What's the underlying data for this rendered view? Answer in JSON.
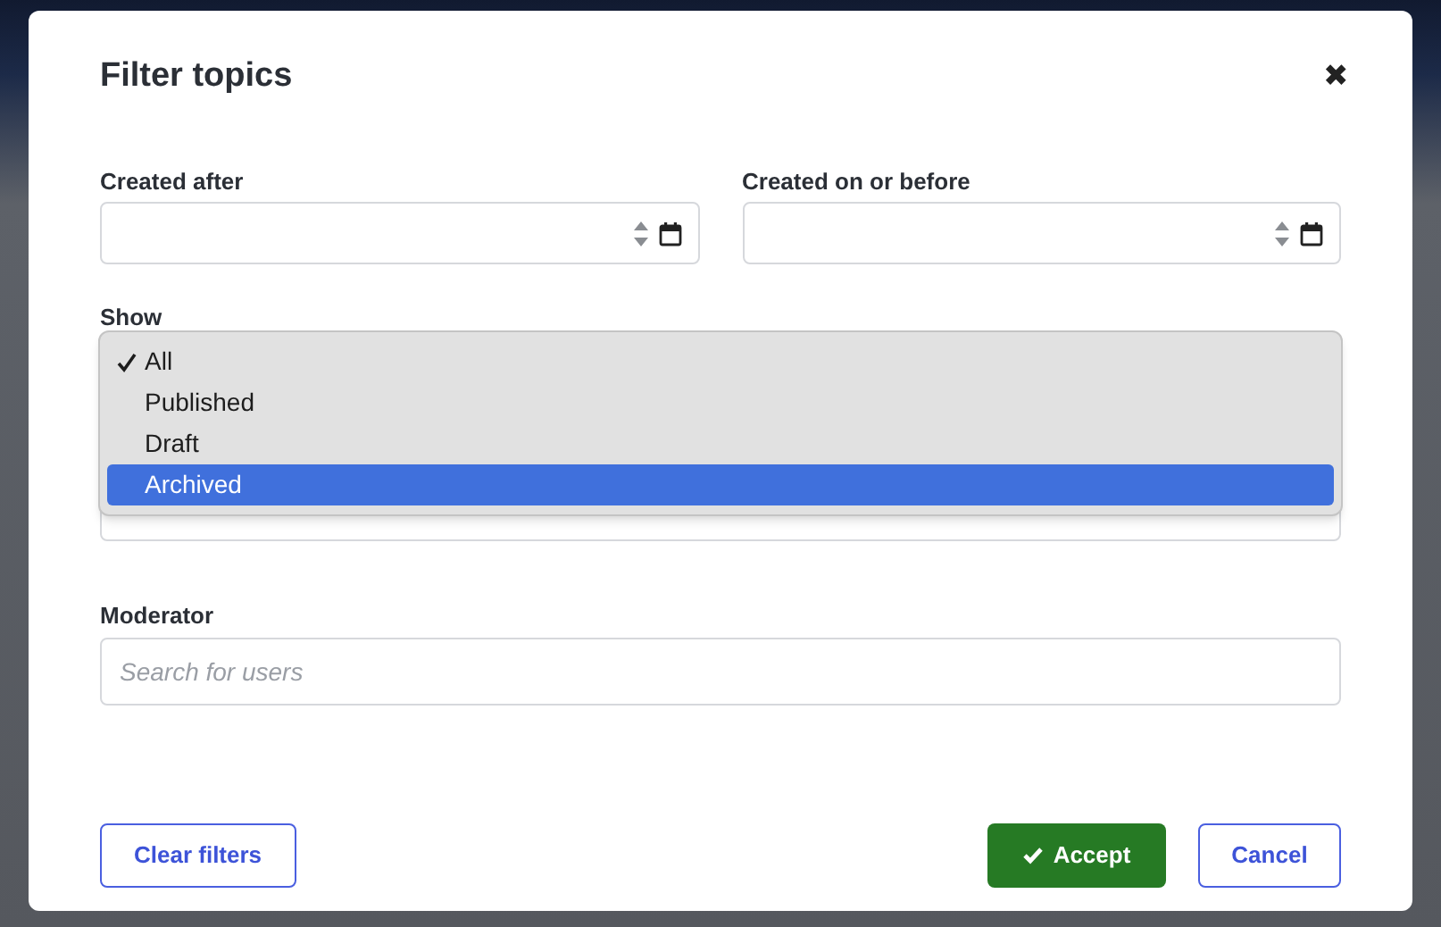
{
  "dialog": {
    "title": "Filter topics",
    "close": "✖"
  },
  "fields": [
    {
      "label": "Created after"
    },
    {
      "label": "Created on or before"
    }
  ],
  "show": {
    "label": "Show",
    "options": [
      {
        "label": "All",
        "checked": true,
        "highlighted": false
      },
      {
        "label": "Published",
        "checked": false,
        "highlighted": false
      },
      {
        "label": "Draft",
        "checked": false,
        "highlighted": false
      },
      {
        "label": "Archived",
        "checked": false,
        "highlighted": true
      }
    ]
  },
  "moderator": {
    "label": "Moderator",
    "placeholder": "Search for users"
  },
  "buttons": {
    "clear": "Clear filters",
    "accept": "Accept",
    "cancel": "Cancel"
  }
}
